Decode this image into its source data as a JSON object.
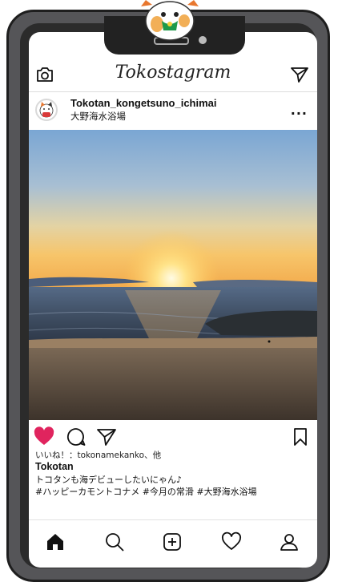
{
  "app": {
    "title": "Tokostagram"
  },
  "post": {
    "username": "Tokotan_kongetsuno_ichimai",
    "location": "大野海水浴場",
    "more_label": "...",
    "likes_text": "いいね！：tokonamekanko、他",
    "caption_user": "Tokotan",
    "caption_text": "トコタンも海デビューしたいにゃん♪",
    "hashtags": "#ハッピーカモントコナメ #今月の常滑 #大野海水浴場",
    "liked": true
  },
  "icons": {
    "header_left": "camera-icon",
    "header_right": "send-icon",
    "post_actions": [
      "heart-icon",
      "comment-icon",
      "send-icon"
    ],
    "post_save": "bookmark-icon",
    "nav": [
      "home-icon",
      "search-icon",
      "add-post-icon",
      "activity-heart-icon",
      "profile-icon"
    ]
  },
  "colors": {
    "like": "#e0245e",
    "phone_frame": "#555558",
    "text": "#111111"
  }
}
